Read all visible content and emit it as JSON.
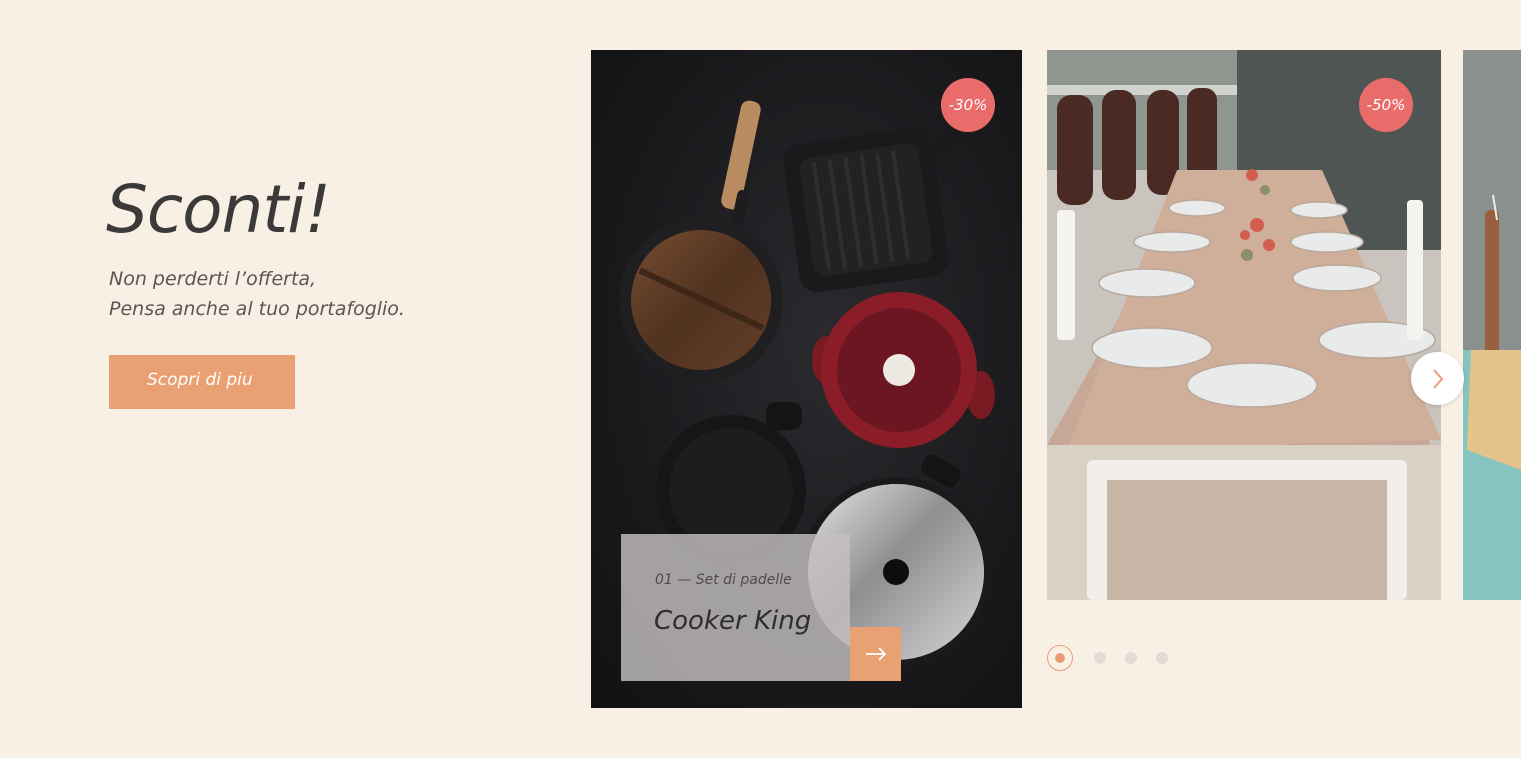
{
  "promo": {
    "title": "Sconti!",
    "subtitle_line1": "Non perderti l’offerta,",
    "subtitle_line2": "Pensa anche al tuo portafoglio.",
    "cta_label": "Scopri di piu"
  },
  "carousel": {
    "slides": [
      {
        "badge": "-30%",
        "meta": "01 — Set di padelle",
        "title": "Cooker King",
        "image": "cookware-set-photo"
      },
      {
        "badge": "-50%",
        "image": "outdoor-dining-table-photo"
      },
      {
        "image": "broom-and-dustpan-photo"
      }
    ],
    "next_icon": "chevron-right-icon",
    "arrow_icon": "arrow-right-icon",
    "pagination": {
      "total": 4,
      "active_index": 0
    }
  },
  "colors": {
    "background": "#f9f0e5",
    "accent": "#e9a072",
    "badge": "#ea6c6a",
    "title_text": "#3c3a39"
  }
}
